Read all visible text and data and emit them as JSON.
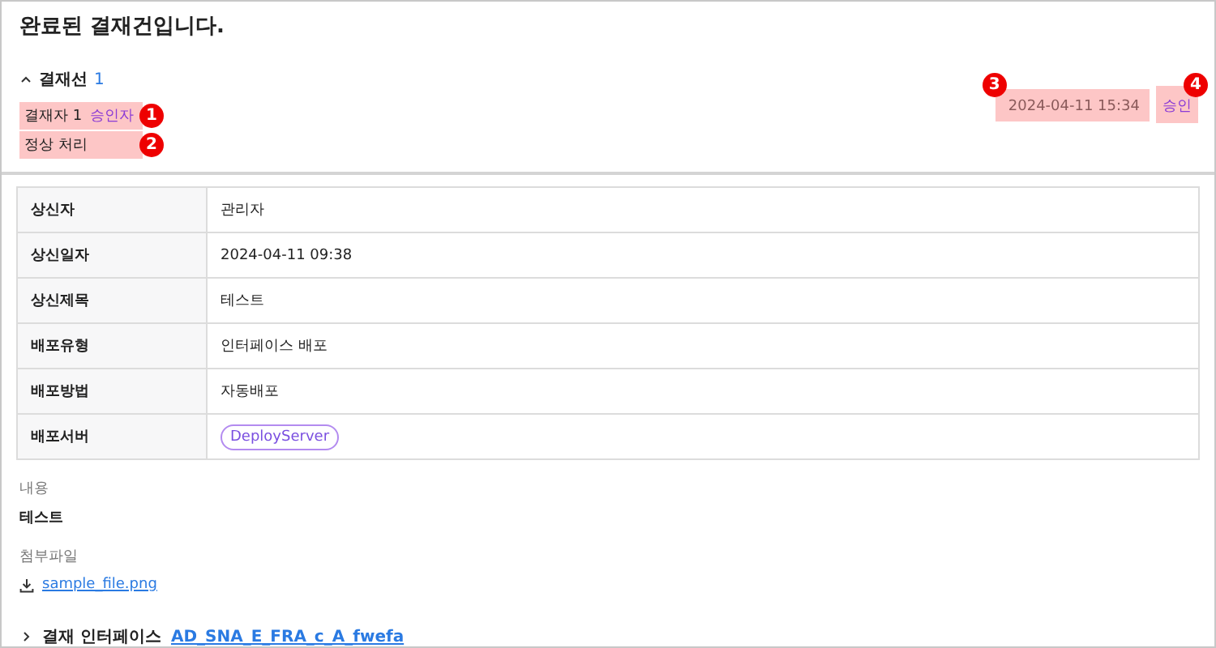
{
  "title": "완료된 결재건입니다.",
  "approval_line": {
    "label": "결재선",
    "count": "1",
    "expanded": true
  },
  "approver": {
    "label": "결재자 1",
    "role": "승인자",
    "result": "정상 처리",
    "date": "2024-04-11 15:34",
    "status": "승인"
  },
  "callouts": [
    "1",
    "2",
    "3",
    "4"
  ],
  "details": [
    {
      "label": "상신자",
      "value": "관리자",
      "kind": "text"
    },
    {
      "label": "상신일자",
      "value": "2024-04-11 09:38",
      "kind": "text"
    },
    {
      "label": "상신제목",
      "value": "테스트",
      "kind": "text"
    },
    {
      "label": "배포유형",
      "value": "인터페이스 배포",
      "kind": "text"
    },
    {
      "label": "배포방법",
      "value": "자동배포",
      "kind": "text"
    },
    {
      "label": "배포서버",
      "value": "DeployServer",
      "kind": "tag"
    }
  ],
  "content": {
    "label": "내용",
    "value": "테스트"
  },
  "attachment": {
    "label": "첨부파일",
    "file": "sample_file.png"
  },
  "interface": {
    "label": "결재 인터페이스",
    "link": "AD_SNA_E_FRA_c_A_fwefa",
    "expanded": false
  }
}
